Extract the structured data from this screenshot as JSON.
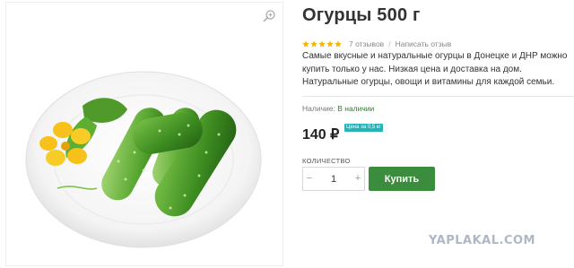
{
  "product": {
    "title": "Огурцы 500 г",
    "rating": 5,
    "reviews_count_label": "7 отзывов",
    "separator": "/",
    "write_review_label": "Написать отзыв",
    "description": "Самые вкусные и натуральные огурцы в Донецке и ДНР можно купить только у нас. Низкая цена и доставка на дом. Натуральные огурцы, овощи и витамины для каждой семьи.",
    "availability_label": "Наличие:",
    "availability_value": "В наличии",
    "price": "140 ₽",
    "price_badge": "Цена за 0,5 кг",
    "quantity_label": "КОЛИЧЕСТВО",
    "quantity_value": "1",
    "minus_label": "−",
    "plus_label": "+",
    "buy_label": "Купить"
  },
  "watermark": "YAPLAKAL.COM",
  "icons": {
    "zoom": "zoom-icon",
    "star": "star-icon"
  },
  "colors": {
    "star": "#f5b301",
    "buy_button": "#3b8d3d",
    "in_stock": "#2e7d32",
    "badge": "#27b3b6"
  }
}
